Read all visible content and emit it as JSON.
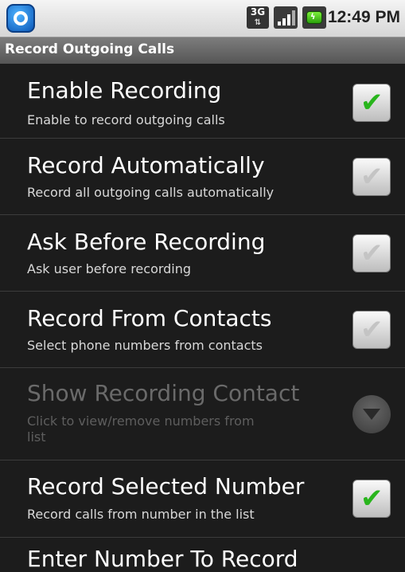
{
  "status_bar": {
    "network_type": "3G",
    "time": "12:49 PM",
    "icons": [
      "app-icon",
      "3g-icon",
      "signal-icon",
      "battery-charging-icon"
    ]
  },
  "title_bar": {
    "title": "Record Outgoing Calls"
  },
  "settings": [
    {
      "title": "Enable Recording",
      "summary": "Enable to record outgoing calls",
      "checked": true
    },
    {
      "title": "Record Automatically",
      "summary": "Record all outgoing calls automatically",
      "checked": false
    },
    {
      "title": "Ask Before Recording",
      "summary": "Ask user before recording",
      "checked": false
    },
    {
      "title": "Record From Contacts",
      "summary": "Select phone numbers from contacts",
      "checked": false
    },
    {
      "title": "Show Recording Contact",
      "summary_line1": "Click to view/remove numbers from",
      "summary_line2": "list",
      "enabled": false,
      "widget": "dropdown"
    },
    {
      "title": "Record Selected Number",
      "summary": "Record calls from number in the list",
      "checked": true
    },
    {
      "title": "Enter Number To Record"
    }
  ],
  "colors": {
    "check_on": "#29b51d",
    "background": "#1c1c1c"
  }
}
